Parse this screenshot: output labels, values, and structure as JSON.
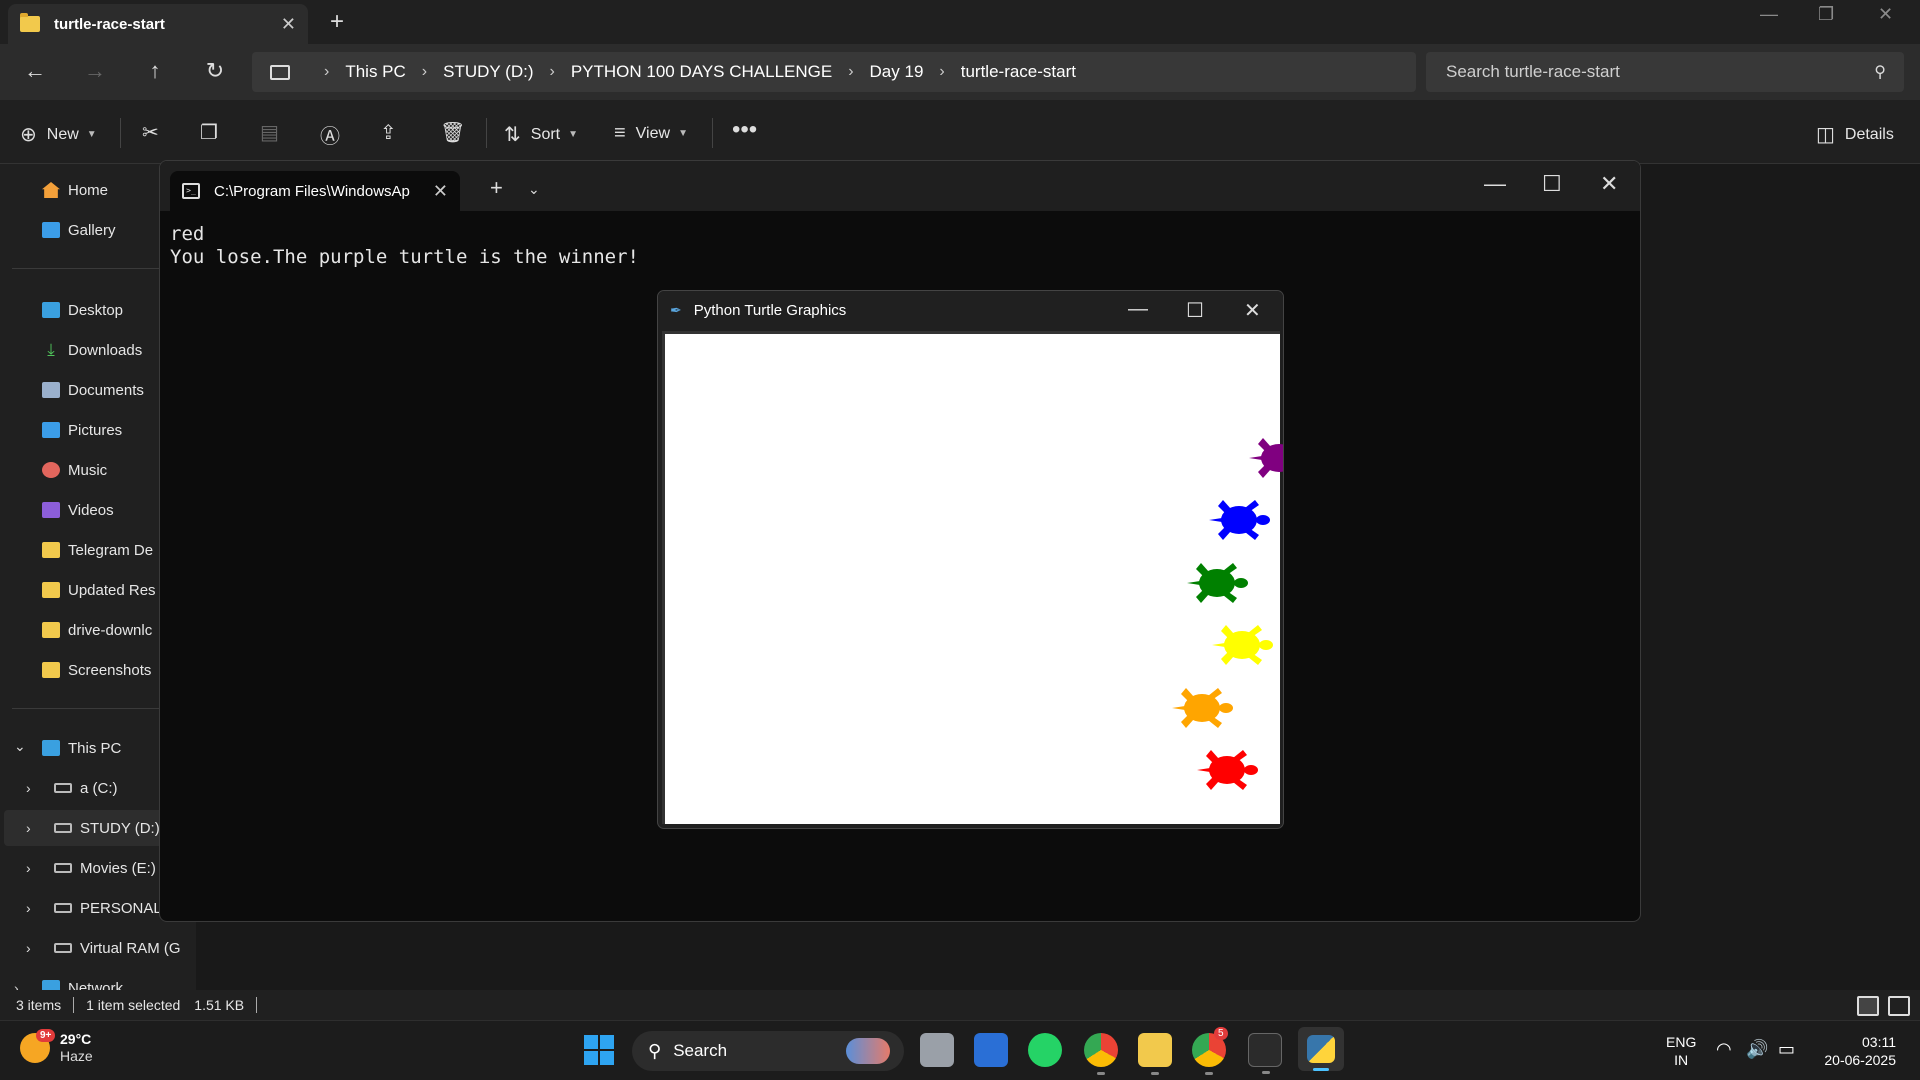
{
  "explorer": {
    "tab_title": "turtle-race-start",
    "breadcrumb": [
      "This PC",
      "STUDY (D:)",
      "PYTHON 100 DAYS CHALLENGE",
      "Day 19",
      "turtle-race-start"
    ],
    "search_placeholder": "Search turtle-race-start",
    "toolbar": {
      "new_label": "New",
      "sort_label": "Sort",
      "view_label": "View",
      "details_label": "Details"
    },
    "sidebar": {
      "quick": [
        {
          "label": "Home",
          "icon": "home-icon"
        },
        {
          "label": "Gallery",
          "icon": "gallery-icon"
        }
      ],
      "pinned": [
        {
          "label": "Desktop",
          "icon": "desktop-icon"
        },
        {
          "label": "Downloads",
          "icon": "downloads-icon"
        },
        {
          "label": "Documents",
          "icon": "documents-icon"
        },
        {
          "label": "Pictures",
          "icon": "pictures-icon"
        },
        {
          "label": "Music",
          "icon": "music-icon"
        },
        {
          "label": "Videos",
          "icon": "videos-icon"
        },
        {
          "label": "Telegram De",
          "icon": "folder-icon"
        },
        {
          "label": "Updated Res",
          "icon": "folder-icon"
        },
        {
          "label": "drive-downlc",
          "icon": "folder-icon"
        },
        {
          "label": "Screenshots",
          "icon": "folder-icon"
        }
      ],
      "this_pc_label": "This PC",
      "drives": [
        {
          "label": "a (C:)"
        },
        {
          "label": "STUDY (D:)"
        },
        {
          "label": "Movies (E:)"
        },
        {
          "label": "PERSONAL ("
        },
        {
          "label": "Virtual RAM (G"
        }
      ],
      "network_label": "Network"
    },
    "status": {
      "items": "3 items",
      "selected": "1 item selected",
      "size": "1.51 KB"
    }
  },
  "terminal": {
    "tab_title": "C:\\Program Files\\WindowsAp",
    "lines": [
      "red",
      "You lose.The purple turtle is the winner!"
    ]
  },
  "turtle_window": {
    "title": "Python Turtle Graphics",
    "turtles": [
      {
        "color": "#800080",
        "name": "purple"
      },
      {
        "color": "#0000ff",
        "name": "blue"
      },
      {
        "color": "#008000",
        "name": "green"
      },
      {
        "color": "#ffff00",
        "name": "yellow"
      },
      {
        "color": "#ffa500",
        "name": "orange"
      },
      {
        "color": "#ff0000",
        "name": "red"
      }
    ]
  },
  "taskbar": {
    "weather_temp": "29°C",
    "weather_cond": "Haze",
    "weather_badge": "9+",
    "search_label": "Search",
    "lang_top": "ENG",
    "lang_bottom": "IN",
    "time": "03:11",
    "date": "20-06-2025",
    "chrome_badge": "5"
  }
}
